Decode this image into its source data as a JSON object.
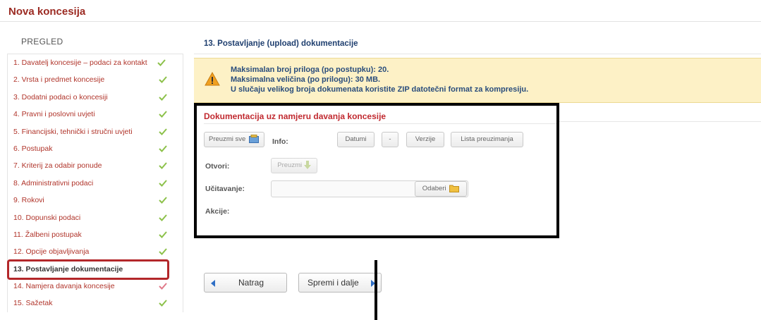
{
  "header": {
    "title": "Nova koncesija"
  },
  "sidebar": {
    "heading": "PREGLED",
    "items": [
      {
        "label": "1. Davatelj koncesije – podaci za kontakt",
        "status": "done"
      },
      {
        "label": "2. Vrsta i predmet koncesije",
        "status": "done"
      },
      {
        "label": "3. Dodatni podaci o koncesiji",
        "status": "done"
      },
      {
        "label": "4. Pravni i poslovni uvjeti",
        "status": "done"
      },
      {
        "label": "5. Financijski, tehnički i stručni uvjeti",
        "status": "done"
      },
      {
        "label": "6. Postupak",
        "status": "done"
      },
      {
        "label": "7. Kriterij za odabir ponude",
        "status": "done"
      },
      {
        "label": "8. Administrativni podaci",
        "status": "done"
      },
      {
        "label": "9. Rokovi",
        "status": "done"
      },
      {
        "label": "10. Dopunski podaci",
        "status": "done"
      },
      {
        "label": "11. Žalbeni postupak",
        "status": "done"
      },
      {
        "label": "12. Opcije objavljivanja",
        "status": "done"
      },
      {
        "label": "13. Postavljanje dokumentacije",
        "status": "current"
      },
      {
        "label": "14. Namjera davanja koncesije",
        "status": "warn"
      },
      {
        "label": "15. Sažetak",
        "status": "done"
      }
    ],
    "colors": {
      "link": "#b0342a",
      "check": "#8cc14a",
      "highlight": "#b3272a"
    }
  },
  "main": {
    "section_title": "13. Postavljanje (upload) dokumentacije",
    "warning": {
      "icon": "warning-icon",
      "lines": [
        "Maksimalan broj priloga (po postupku): 20.",
        "Maksimalna veličina (po prilogu): 30 MB.",
        "U slučaju velikog broja dokumenata koristite ZIP datotečni format za kompresiju."
      ]
    },
    "doc": {
      "title": "Dokumentacija uz namjeru davanja koncesije",
      "download_all": "Preuzmi sve",
      "info_label": "Info:",
      "datumi": "Datumi",
      "dash": "-",
      "verzije": "Verzije",
      "lista": "Lista preuzimanja",
      "otvori_label": "Otvori:",
      "preuzmi": "Preuzmi",
      "upload_label": "Učitavanje:",
      "odaberi": "Odaberi",
      "akcije_label": "Akcije:"
    },
    "nav": {
      "back": "Natrag",
      "next": "Spremi i dalje"
    }
  }
}
